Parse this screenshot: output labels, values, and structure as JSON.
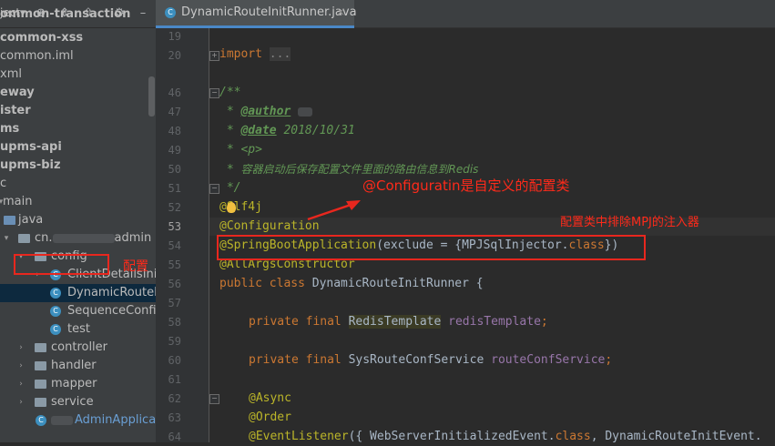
{
  "project": {
    "toolbar_title": "ject",
    "tree": [
      {
        "label": "ommon-transaction",
        "bold": true
      },
      {
        "label": "common-xss",
        "bold": true
      },
      {
        "label": "common.iml"
      },
      {
        "label": "xml"
      },
      {
        "label": "eway",
        "bold": true
      },
      {
        "label": "ister",
        "bold": true
      },
      {
        "label": "ms",
        "bold": true
      },
      {
        "label": "upms-api",
        "bold": true
      },
      {
        "label": "upms-biz",
        "bold": true
      },
      {
        "label": "c"
      },
      {
        "label": "main"
      },
      {
        "label": "java"
      },
      {
        "label": "cn.",
        "suffix": "admin"
      },
      {
        "label": "config"
      },
      {
        "label": "ClientDetailsInitR"
      },
      {
        "label": "DynamicRouteIni"
      },
      {
        "label": "SequenceConfig"
      },
      {
        "label": "test"
      },
      {
        "label": "controller"
      },
      {
        "label": "handler"
      },
      {
        "label": "mapper"
      },
      {
        "label": "service"
      },
      {
        "label": "AdminApplicatio"
      }
    ]
  },
  "editor": {
    "tab_label": "DynamicRouteInitRunner.java",
    "lines": {
      "n19": "19",
      "n20": "20",
      "n46": "46",
      "n47": "47",
      "n48": "48",
      "n49": "49",
      "n50": "50",
      "n51": "51",
      "n52": "52",
      "n53": "53",
      "n54": "54",
      "n55": "55",
      "n56": "56",
      "n57": "57",
      "n58": "58",
      "n59": "59",
      "n60": "60",
      "n61": "61",
      "n62": "62",
      "n63": "63",
      "n64": "64"
    },
    "code": {
      "import_kw": "import",
      "import_dots": "...",
      "jdoc_open": "/**",
      "star": " * ",
      "author_tag": "@author",
      "date_tag": "@date",
      "date_val": " 2018/10/31",
      "p_tag": "<p>",
      "desc": "容器启动后保存配置文件里面的路由信息到Redis",
      "jdoc_close": " */",
      "slf4j": "@Slf4j",
      "configuration": "@Configuration",
      "sba_annot": "@SpringBootApplication",
      "sba_rest": "(exclude = {MPJSqlInjector.",
      "class_kw": "class",
      "sba_end": "})",
      "allargs": "@AllArgsConstructor",
      "public_class": "public class ",
      "class_name": "DynamicRouteInitRunner {",
      "private_final": "private final ",
      "redis_type": "RedisTemplate",
      "redis_field": "redisTemplate",
      "semi": ";",
      "sys_type": "SysRouteConfService ",
      "sys_field": "routeConfService",
      "async": "@Async",
      "order": "@Order",
      "event_listener": "@EventListener",
      "event_args": "({ WebServerInitializedEvent.",
      "event_args2": ", DynamicRouteInitEvent."
    }
  },
  "annotations": {
    "config_label": "配置",
    "configuration_note": "@Configuratin是自定义的配置类",
    "exclude_note": "配置类中排除MPJ的注入器"
  },
  "colors": {
    "keyword": "#cc7832",
    "annotation": "#bbb529",
    "comment": "#629755",
    "field": "#9876aa",
    "annotation_red": "#e8271e"
  }
}
